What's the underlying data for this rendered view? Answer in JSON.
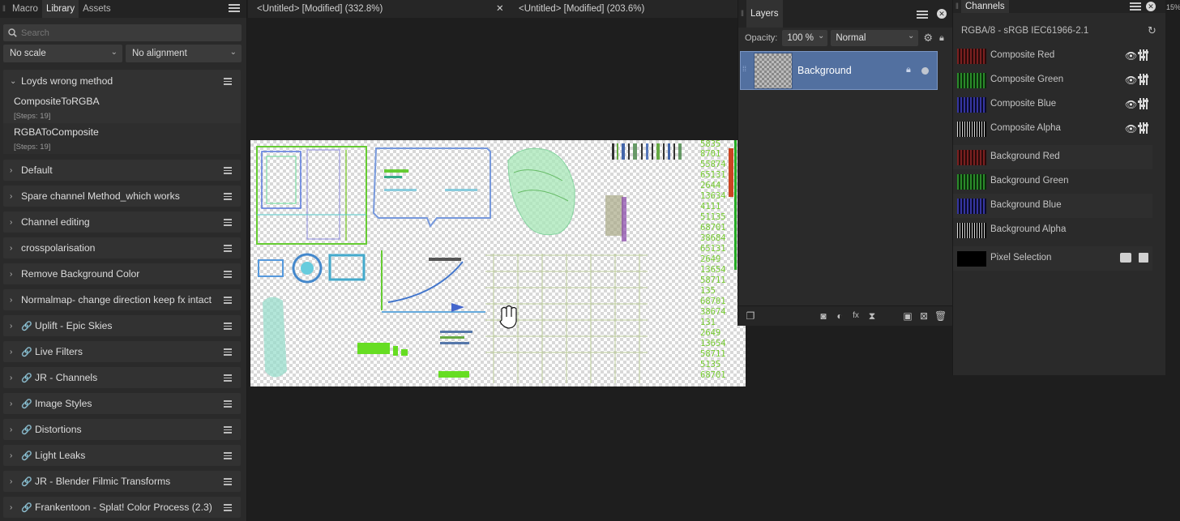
{
  "library_panel": {
    "tabs": [
      {
        "label": "Macro"
      },
      {
        "label": "Library"
      },
      {
        "label": "Assets"
      }
    ],
    "search": {
      "placeholder": "Search"
    },
    "scale_dropdown": "No scale",
    "alignment_dropdown": "No alignment",
    "expanded_group": {
      "name": "Loyds wrong method",
      "macros": [
        {
          "name": "CompositeToRGBA",
          "steps": "[Steps: 19]"
        },
        {
          "name": "RGBAToComposite",
          "steps": "[Steps: 19]"
        }
      ]
    },
    "groups": [
      {
        "name": "Default"
      },
      {
        "name": "Spare channel Method_which works"
      },
      {
        "name": "Channel editing"
      },
      {
        "name": "crosspolarisation"
      },
      {
        "name": "Remove Background Color"
      },
      {
        "name": "Normalmap- change direction keep fx intact"
      },
      {
        "name": "Uplift - Epic Skies"
      },
      {
        "name": "Live Filters"
      },
      {
        "name": "JR - Channels"
      },
      {
        "name": "Image Styles"
      },
      {
        "name": "Distortions"
      },
      {
        "name": "Light Leaks"
      },
      {
        "name": "JR - Blender Filmic Transforms"
      },
      {
        "name": "Frankentoon - Splat! Color Process (2.3)"
      }
    ]
  },
  "documents": {
    "tabs": [
      {
        "label": "<Untitled> [Modified] (332.8%)"
      },
      {
        "label": "<Untitled> [Modified] (203.6%)"
      }
    ]
  },
  "layers_panel": {
    "title": "Layers",
    "opacity_label": "Opacity:",
    "opacity_value": "100 %",
    "blend_mode": "Normal",
    "layers": [
      {
        "name": "Background"
      }
    ]
  },
  "channels_panel": {
    "title": "Channels",
    "format": "RGBA/8 - sRGB IEC61966-2.1",
    "composite": [
      {
        "name": "Composite Red",
        "color": "#c03030"
      },
      {
        "name": "Composite Green",
        "color": "#30b030"
      },
      {
        "name": "Composite Blue",
        "color": "#4040c8"
      },
      {
        "name": "Composite Alpha",
        "color": "#e0e0e0"
      }
    ],
    "background": [
      {
        "name": "Background Red",
        "color": "#c03030"
      },
      {
        "name": "Background Green",
        "color": "#30b030"
      },
      {
        "name": "Background Blue",
        "color": "#4040c8"
      },
      {
        "name": "Background Alpha",
        "color": "#e0e0e0"
      }
    ],
    "pixel_selection": "Pixel Selection"
  },
  "right_edge_text": "15%"
}
